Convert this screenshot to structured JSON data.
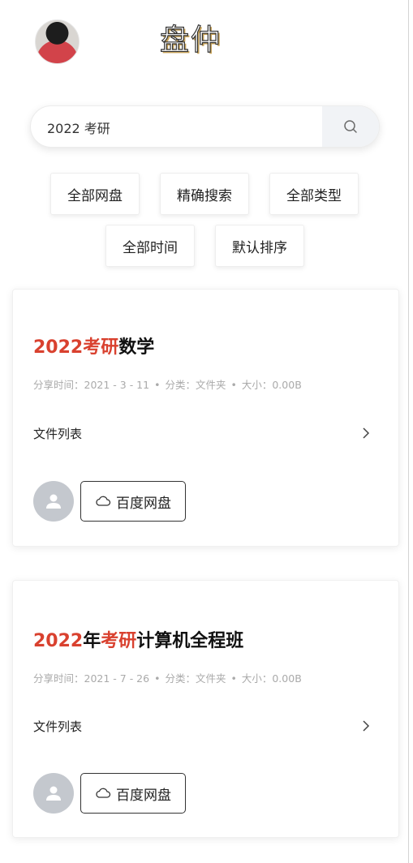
{
  "header": {
    "logo_text": "盘仲",
    "avatar_icon": "user-photo"
  },
  "search": {
    "value": "2022 考研",
    "icon": "search-icon"
  },
  "filters": [
    {
      "label": "全部网盘"
    },
    {
      "label": "精确搜索"
    },
    {
      "label": "全部类型"
    },
    {
      "label": "全部时间"
    },
    {
      "label": "默认排序"
    }
  ],
  "results": [
    {
      "title_parts": [
        {
          "text": "2022",
          "highlight": true
        },
        {
          "text": "考研",
          "highlight": true
        },
        {
          "text": "数学",
          "highlight": false
        }
      ],
      "share_time": "分享时间：2021 - 3 - 11",
      "category": "分类：文件夹",
      "size": "大小：0.00B",
      "file_list_label": "文件列表",
      "source_label": "百度网盘"
    },
    {
      "title_parts": [
        {
          "text": "2022",
          "highlight": true
        },
        {
          "text": "年",
          "highlight": false
        },
        {
          "text": "考研",
          "highlight": true
        },
        {
          "text": "计算机全程班",
          "highlight": false
        }
      ],
      "share_time": "分享时间：2021 - 7 - 26",
      "category": "分类：文件夹",
      "size": "大小：0.00B",
      "file_list_label": "文件列表",
      "source_label": "百度网盘"
    }
  ],
  "colors": {
    "highlight": "#d9412f",
    "meta_text": "#aaaaaa",
    "avatar_placeholder": "#c4c8ce"
  }
}
